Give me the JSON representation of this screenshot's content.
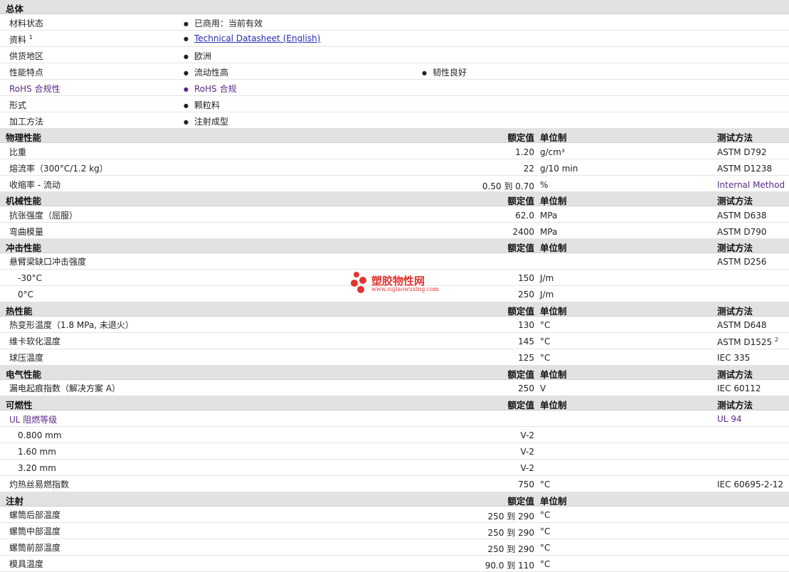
{
  "overview": {
    "title": "总体",
    "rows": [
      {
        "label": "材料状态",
        "value": "已商用：当前有效"
      },
      {
        "label": "资料",
        "sup": "1",
        "link": "Technical Datasheet (English)"
      },
      {
        "label": "供货地区",
        "value": "欧洲"
      },
      {
        "label": "性能特点",
        "value": "流动性高",
        "value2": "韧性良好"
      },
      {
        "label": "RoHS 合规性",
        "value": "RoHS 合规"
      },
      {
        "label": "形式",
        "value": "颗粒料"
      },
      {
        "label": "加工方法",
        "value": "注射成型"
      }
    ]
  },
  "columns": {
    "nominal": "额定值",
    "unit": "单位制",
    "method": "测试方法"
  },
  "physical": {
    "title": "物理性能",
    "rows": [
      {
        "label": "比重",
        "value": "1.20",
        "unit": "g/cm³",
        "method": "ASTM D792"
      },
      {
        "label": "熔流率（300°C/1.2 kg）",
        "value": "22",
        "unit": "g/10 min",
        "method": "ASTM D1238"
      },
      {
        "label": "收缩率 - 流动",
        "value": "0.50 到  0.70",
        "unit": "%",
        "method": "Internal Method"
      }
    ]
  },
  "mechanical": {
    "title": "机械性能",
    "rows": [
      {
        "label": "抗张强度（屈服）",
        "value": "62.0",
        "unit": "MPa",
        "method": "ASTM D638"
      },
      {
        "label": "弯曲模量",
        "value": "2400",
        "unit": "MPa",
        "method": "ASTM D790"
      }
    ]
  },
  "impact": {
    "title": "冲击性能",
    "rows": [
      {
        "label": "悬臂梁缺口冲击强度",
        "method": "ASTM D256"
      },
      {
        "label": "-30°C",
        "value": "150",
        "unit": "J/m"
      },
      {
        "label": "0°C",
        "value": "250",
        "unit": "J/m"
      }
    ]
  },
  "thermal": {
    "title": "热性能",
    "rows": [
      {
        "label": "热变形温度（1.8 MPa, 未退火）",
        "value": "130",
        "unit": "°C",
        "method": "ASTM D648"
      },
      {
        "label": "维卡软化温度",
        "value": "145",
        "unit": "°C",
        "method": "ASTM D1525",
        "sup": "2"
      },
      {
        "label": "球压温度",
        "value": "125",
        "unit": "°C",
        "method": "IEC 335"
      }
    ]
  },
  "electrical": {
    "title": "电气性能",
    "rows": [
      {
        "label": "漏电起痕指数（解决方案 A）",
        "value": "250",
        "unit": "V",
        "method": "IEC 60112"
      }
    ]
  },
  "flammability": {
    "title": "可燃性",
    "rows": [
      {
        "label": "UL 阻燃等级",
        "method": "UL 94"
      },
      {
        "label": "0.800 mm",
        "value": "V-2"
      },
      {
        "label": "1.60 mm",
        "value": "V-2"
      },
      {
        "label": "3.20 mm",
        "value": "V-2"
      },
      {
        "label": "灼热丝易燃指数",
        "value": "750",
        "unit": "°C",
        "method": "IEC 60695-2-12"
      }
    ]
  },
  "injection": {
    "title": "注射",
    "rows": [
      {
        "label": "螺筒后部温度",
        "value": "250 到  290",
        "unit": "°C"
      },
      {
        "label": "螺筒中部温度",
        "value": "250 到  290",
        "unit": "°C"
      },
      {
        "label": "螺筒前部温度",
        "value": "250 到  290",
        "unit": "°C"
      },
      {
        "label": "模具温度",
        "value": "90.0 到  110",
        "unit": "°C"
      }
    ]
  },
  "watermark": {
    "cn": "塑胶物性网",
    "en": "www.sujiaowuxing.com"
  }
}
